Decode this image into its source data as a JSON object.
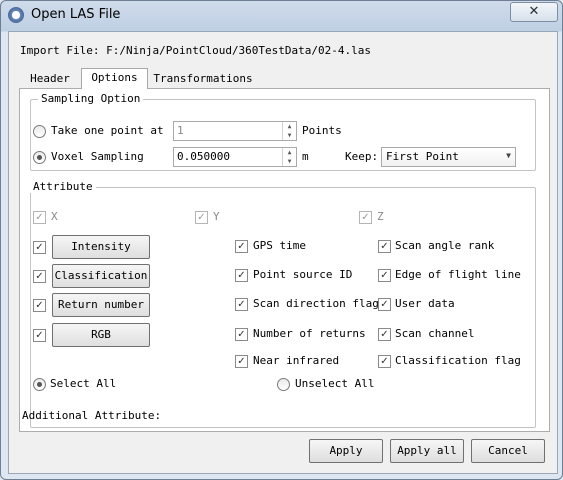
{
  "window": {
    "title": "Open LAS File",
    "close_symbol": "✕"
  },
  "import_file": {
    "label": "Import File:",
    "path": "F:/Ninja/PointCloud/360TestData/02-4.las"
  },
  "tabs": [
    {
      "label": "Header",
      "selected": false
    },
    {
      "label": "Options",
      "selected": true
    },
    {
      "label": "Transformations",
      "selected": false
    }
  ],
  "sampling": {
    "group_label": "Sampling Option",
    "take_one": {
      "label": "Take one point at",
      "value": "1",
      "unit": "Points",
      "selected": false
    },
    "voxel": {
      "label": "Voxel Sampling",
      "value": "0.050000",
      "unit": "m",
      "selected": true
    },
    "keep": {
      "label": "Keep:",
      "value": "First Point"
    }
  },
  "attribute": {
    "group_label": "Attribute",
    "xyz": [
      "X",
      "Y",
      "Z"
    ],
    "left_items": [
      "Intensity",
      "Classification",
      "Return number",
      "RGB"
    ],
    "mid_items": [
      "GPS time",
      "Point source ID",
      "Scan direction flag",
      "Number of returns",
      "Near infrared"
    ],
    "right_items": [
      "Scan angle rank",
      "Edge of flight line",
      "User data",
      "Scan channel",
      "Classification flag"
    ],
    "select_all": "Select All",
    "unselect_all": "Unselect All"
  },
  "additional_attribute": "Additional Attribute:",
  "buttons": {
    "apply": "Apply",
    "apply_all": "Apply all",
    "cancel": "Cancel"
  },
  "check_mark": "✓"
}
